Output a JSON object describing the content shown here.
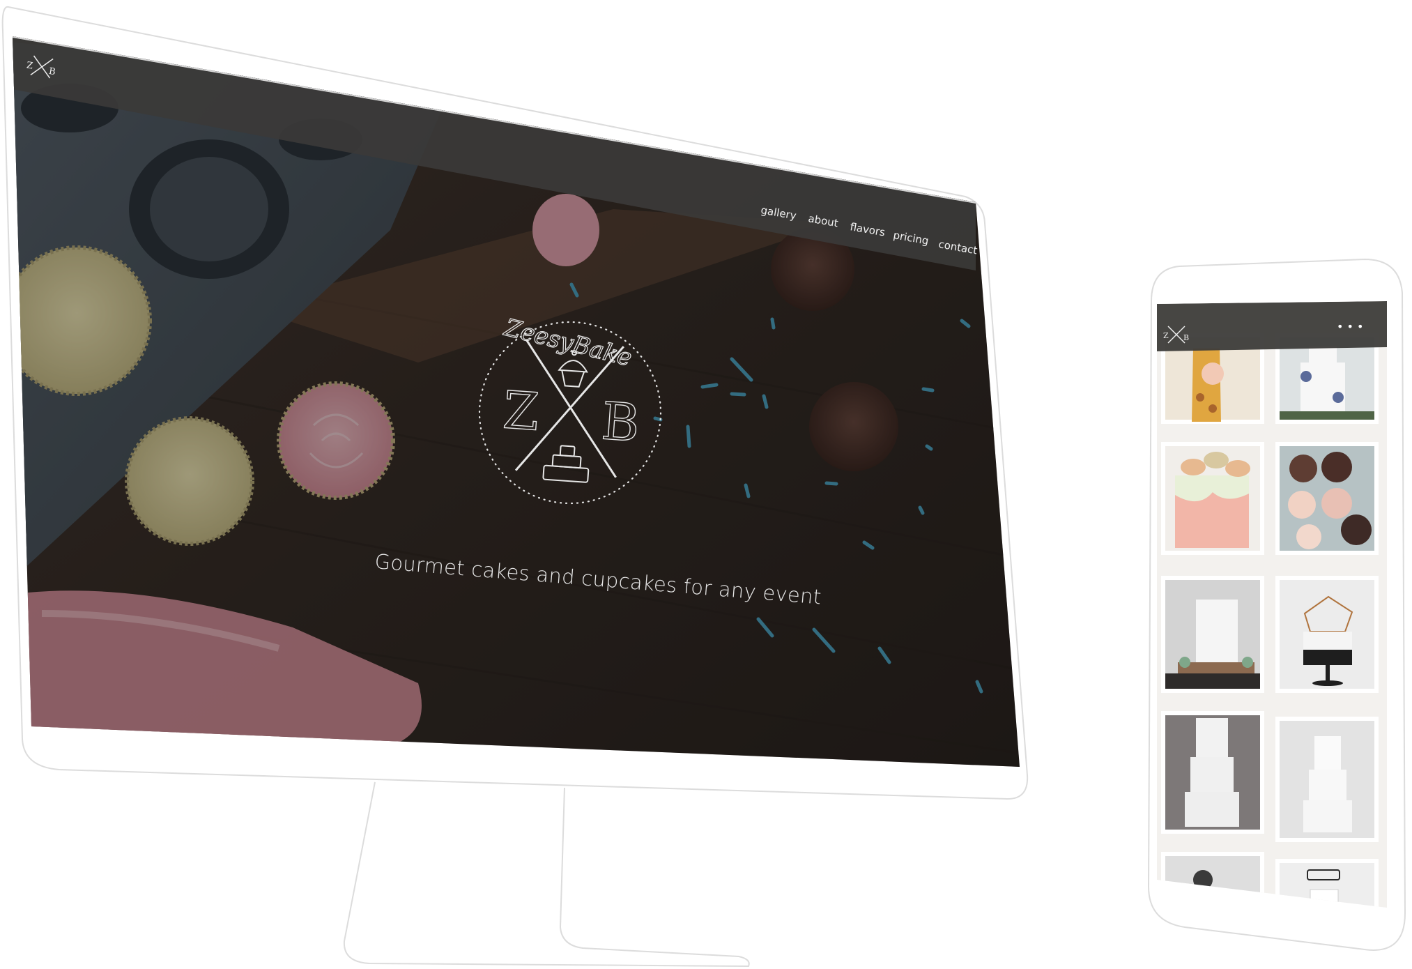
{
  "site": {
    "logo_initials": {
      "left": "Z",
      "right": "B"
    },
    "brand_name": "ZeesyBake",
    "tagline": "Gourmet cakes and cupcakes for any event"
  },
  "nav": {
    "items": [
      {
        "id": "gallery",
        "label": "gallery"
      },
      {
        "id": "about",
        "label": "about"
      },
      {
        "id": "flavors",
        "label": "flavors"
      },
      {
        "id": "pricing",
        "label": "pricing"
      },
      {
        "id": "contact",
        "label": "contact"
      }
    ]
  },
  "mobile": {
    "menu_label": "• • •",
    "gallery_tiles": [
      {
        "name": "giraffe-cake"
      },
      {
        "name": "white-floral-wedding-cake"
      },
      {
        "name": "macaron-drip-cake"
      },
      {
        "name": "chocolate-macarons"
      },
      {
        "name": "white-floral-drip-cake"
      },
      {
        "name": "geometric-elephant-cake"
      },
      {
        "name": "textured-white-tier-cake"
      },
      {
        "name": "smooth-white-tier-cake"
      },
      {
        "name": "partial-tile-left"
      },
      {
        "name": "topper-tile-right"
      }
    ]
  },
  "colors": {
    "header_bar": "#3b3a38",
    "hero_wood": "#3a302a",
    "frosting_pink": "#e79aa6",
    "sprinkle_blue": "#4fa6c5",
    "device_outline": "#d8d8d8"
  }
}
